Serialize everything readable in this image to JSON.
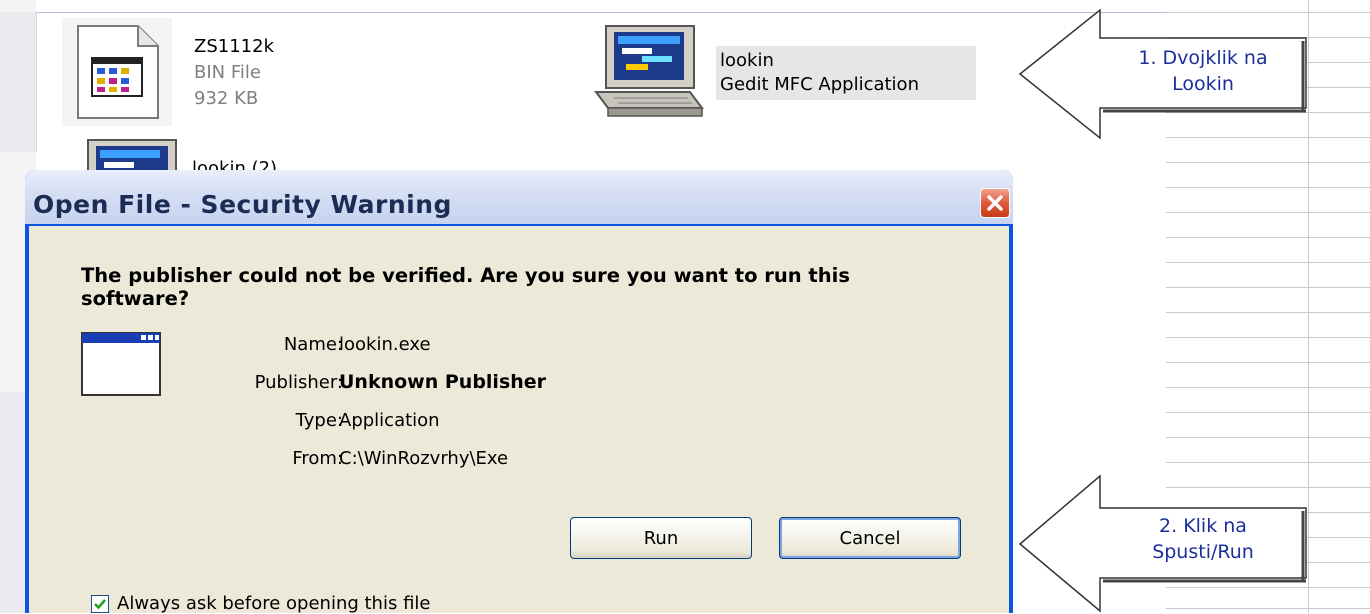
{
  "explorer": {
    "files": [
      {
        "name": "ZS1112k",
        "type": "BIN File",
        "size": "932 KB"
      },
      {
        "name": "lookin",
        "type": "Gedit MFC Application"
      },
      {
        "name": "lookin (2)"
      }
    ]
  },
  "dialog": {
    "title": "Open File - Security Warning",
    "heading": "The publisher could not be verified.  Are you sure you want to run this software?",
    "fields": [
      {
        "label": "Name:",
        "value": "lookin.exe"
      },
      {
        "label": "Publisher:",
        "value": "Unknown Publisher"
      },
      {
        "label": "Type:",
        "value": "Application"
      },
      {
        "label": "From:",
        "value": "C:\\WinRozvrhy\\Exe"
      }
    ],
    "buttons": {
      "run": "Run",
      "cancel": "Cancel"
    },
    "always_ask": {
      "label": "Always ask before opening this file",
      "checked": true
    }
  },
  "callouts": [
    {
      "line1": "1. Dvojklik na",
      "line2": "Lookin"
    },
    {
      "line1": "2. Klik na",
      "line2": "Spusti/Run"
    }
  ],
  "colors": {
    "dialog_frame": "#0b55e0",
    "dialog_body": "#ece9d8",
    "close_button": "#e05a3a",
    "callout_text": "#1b2f9c"
  }
}
